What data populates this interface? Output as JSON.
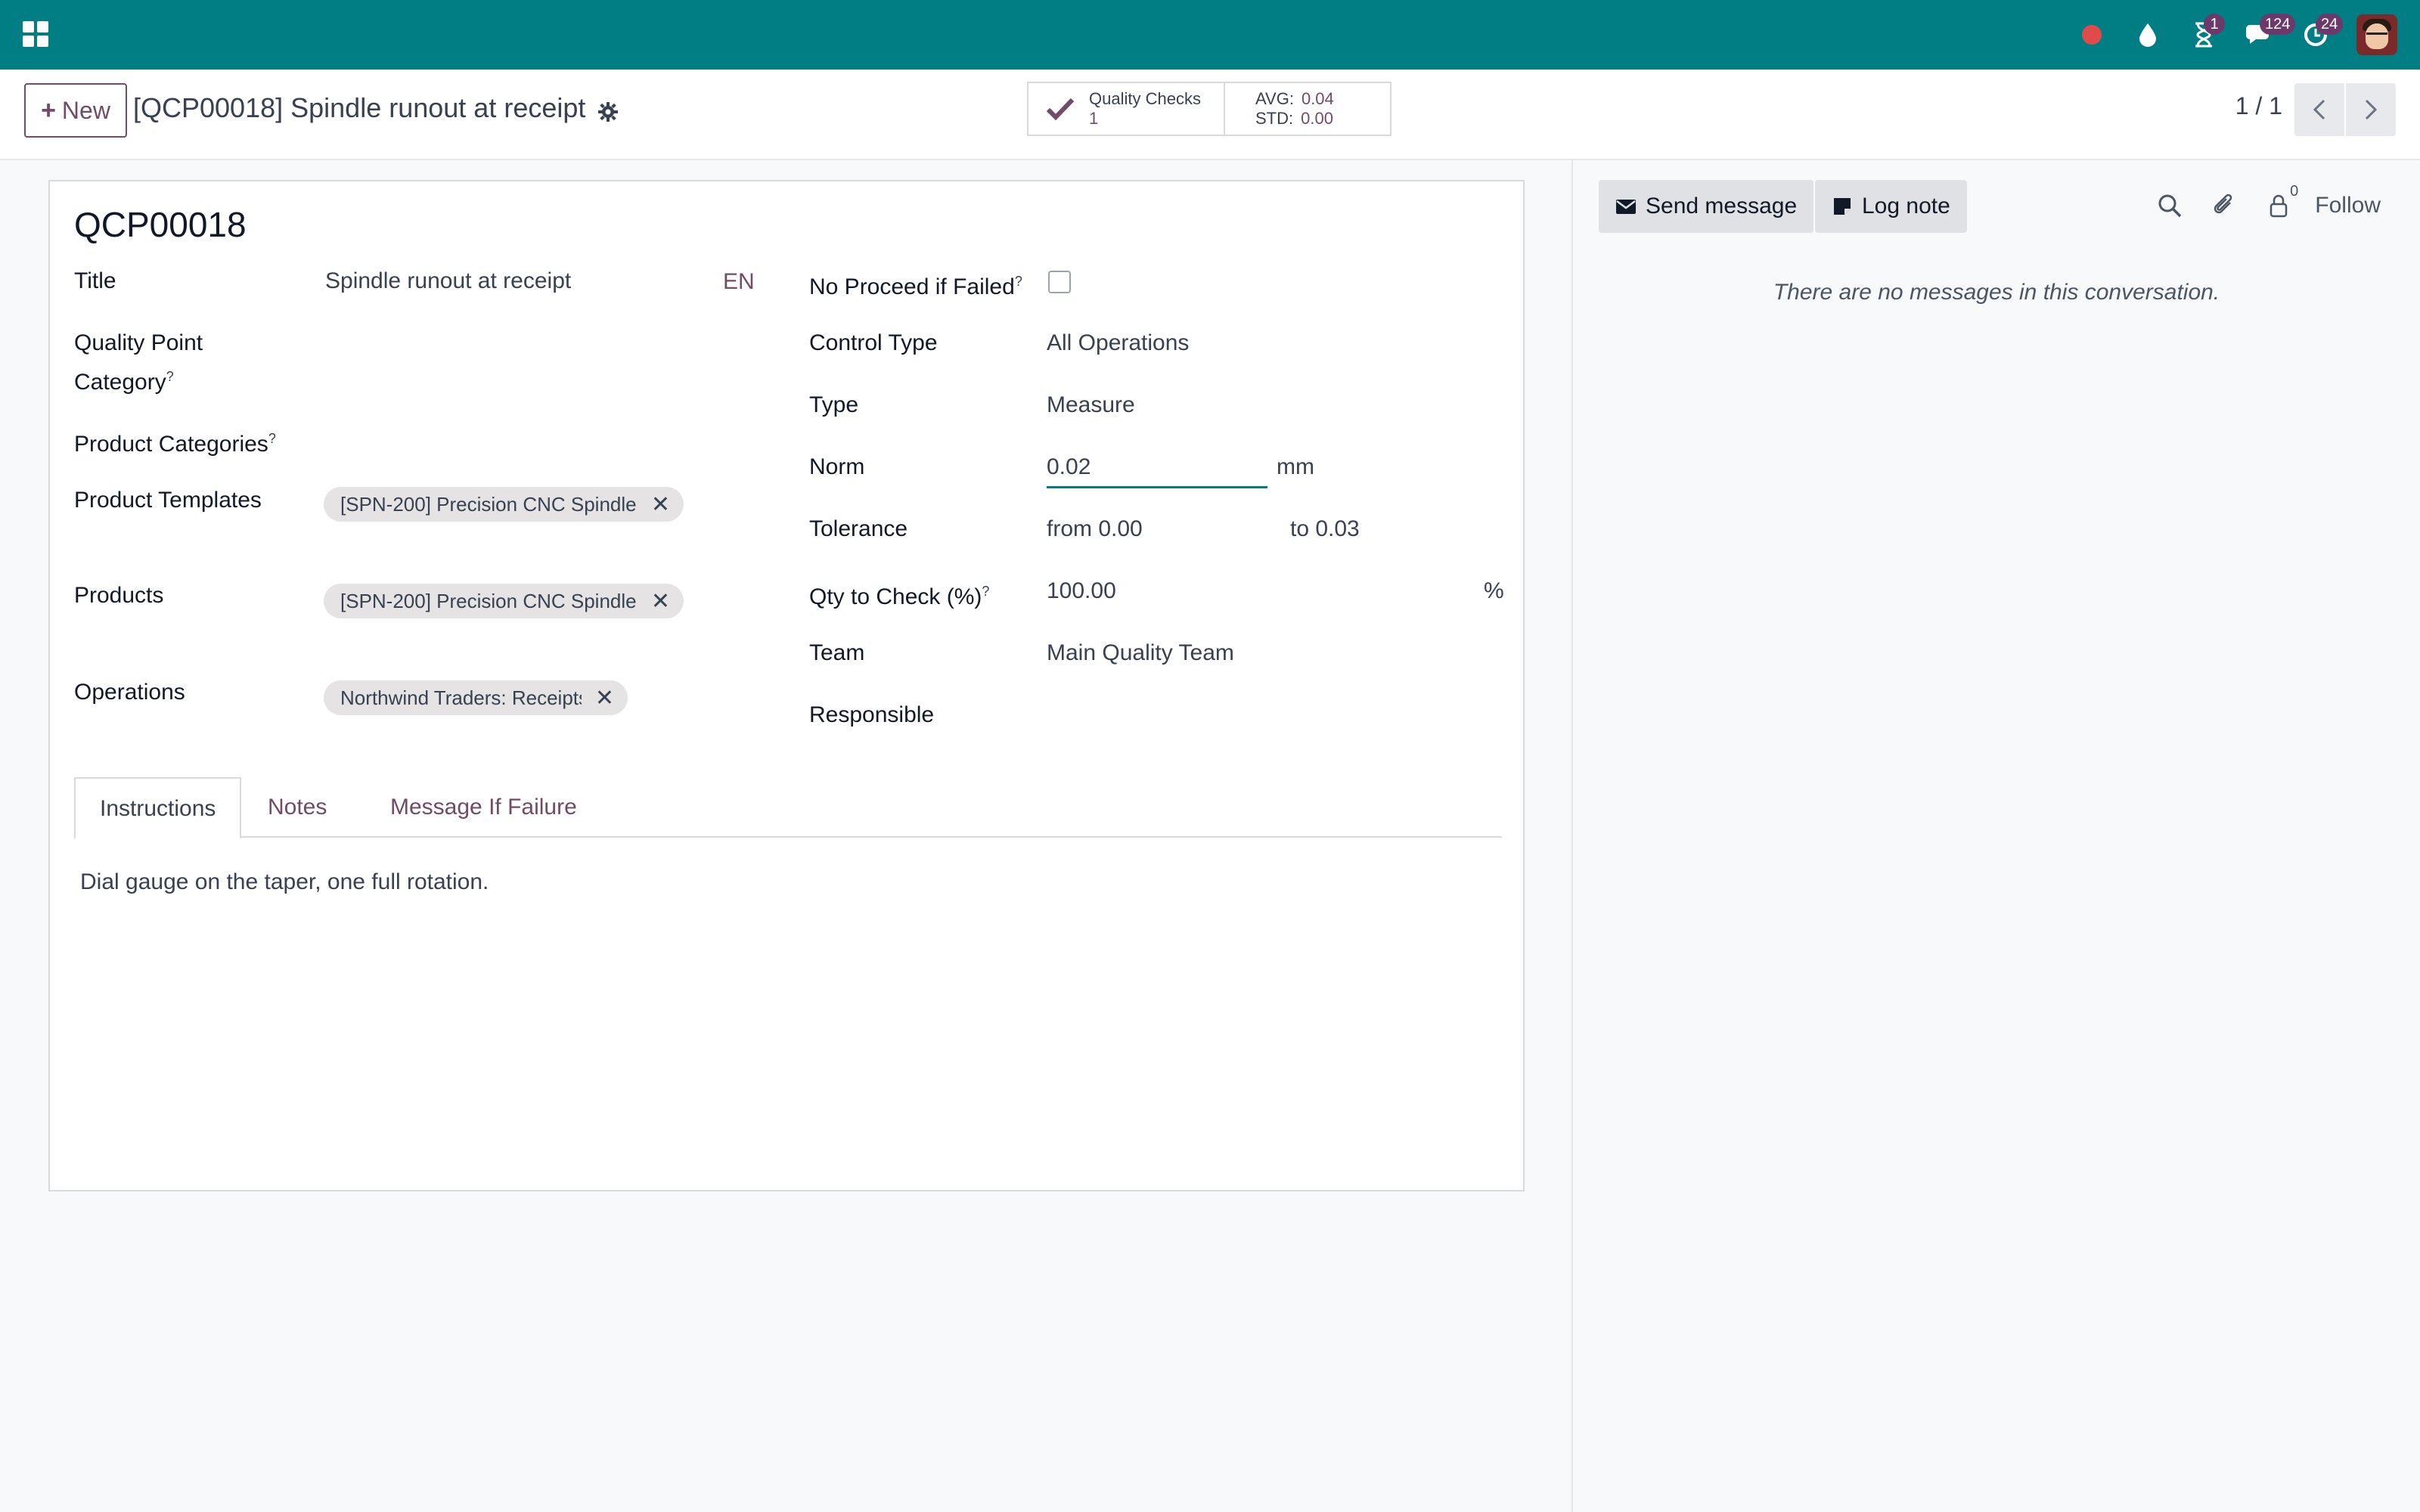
{
  "navbar": {
    "bg_color": "#017e84",
    "icons": [
      "apps-icon",
      "recording-dot-icon",
      "drop-icon",
      "hourglass-icon",
      "chat-icon",
      "clock-icon"
    ],
    "badges": {
      "activities": "1",
      "messages": "124",
      "reminders": "24"
    }
  },
  "control_panel": {
    "new_label": "New",
    "breadcrumb": "[QCP00018] Spindle runout at receipt",
    "smart_button": {
      "label": "Quality Checks",
      "count": "1",
      "avg_label": "AVG:",
      "avg_value": "0.04",
      "std_label": "STD:",
      "std_value": "0.00"
    },
    "pager": "1 / 1"
  },
  "form": {
    "record_name": "QCP00018",
    "left": {
      "title_label": "Title",
      "title_value": "Spindle runout at receipt",
      "lang": "EN",
      "qp_category_label_1": "Quality Point",
      "qp_category_label_2": "Category",
      "product_categories_label": "Product Categories",
      "product_templates_label": "Product Templates",
      "product_templates_tag": "[SPN-200] Precision CNC Spindle ...",
      "products_label": "Products",
      "products_tag": "[SPN-200] Precision CNC Spindle ...",
      "operations_label": "Operations",
      "operations_tag": "Northwind Traders: Receipts",
      "help_marker": "?"
    },
    "right": {
      "no_proceed_label": "No Proceed if Failed",
      "no_proceed_checked": false,
      "control_type_label": "Control Type",
      "control_type_value": "All Operations",
      "type_label": "Type",
      "type_value": "Measure",
      "norm_label": "Norm",
      "norm_value": "0.02",
      "norm_unit": "mm",
      "tolerance_label": "Tolerance",
      "tolerance_from": "from 0.00",
      "tolerance_to": "to 0.03",
      "qty_label": "Qty to Check (%)",
      "qty_value": "100.00",
      "qty_unit": "%",
      "team_label": "Team",
      "team_value": "Main Quality Team",
      "responsible_label": "Responsible"
    },
    "tabs": [
      "Instructions",
      "Notes",
      "Message If Failure"
    ],
    "instructions": "Dial gauge on the taper, one full rotation."
  },
  "chatter": {
    "send_message": "Send message",
    "log_note": "Log note",
    "follower_count": "0",
    "follow": "Follow",
    "empty": "There are no messages in this conversation."
  },
  "colors": {
    "accent": "#714b67",
    "brand": "#017e84"
  }
}
